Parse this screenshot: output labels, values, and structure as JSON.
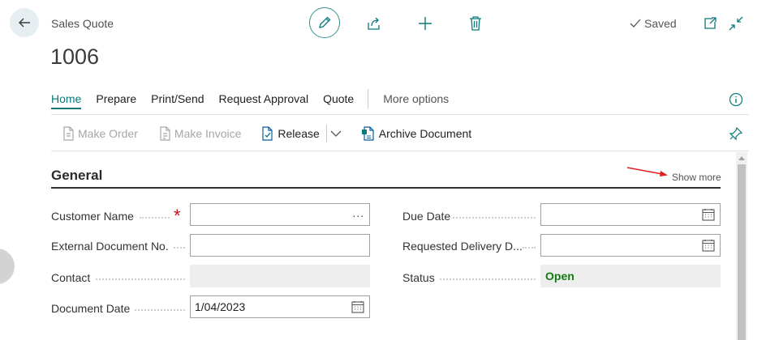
{
  "header": {
    "page_type": "Sales Quote",
    "document_number": "1006",
    "saved_label": "Saved",
    "icons": {
      "back": "back-arrow-icon",
      "edit": "pencil-icon",
      "share": "share-icon",
      "new": "plus-icon",
      "delete": "trash-icon",
      "saved": "checkmark-icon",
      "open_new_window": "open-new-window-icon",
      "collapse": "collapse-icon"
    }
  },
  "tabs": [
    {
      "label": "Home",
      "active": true
    },
    {
      "label": "Prepare"
    },
    {
      "label": "Print/Send"
    },
    {
      "label": "Request Approval"
    },
    {
      "label": "Quote"
    }
  ],
  "more_options_label": "More options",
  "actions": {
    "make_order": "Make Order",
    "make_invoice": "Make Invoice",
    "release": "Release",
    "archive": "Archive Document"
  },
  "general": {
    "title": "General",
    "show_more": "Show more",
    "fields": {
      "customer_name": {
        "label": "Customer Name",
        "value": "",
        "required": true,
        "lookup_icon": "..."
      },
      "external_doc_no": {
        "label": "External Document No.",
        "value": ""
      },
      "contact": {
        "label": "Contact",
        "value": ""
      },
      "document_date": {
        "label": "Document Date",
        "value": "1/04/2023"
      },
      "due_date": {
        "label": "Due Date",
        "value": ""
      },
      "requested_delivery": {
        "label": "Requested Delivery D...",
        "value": ""
      },
      "status": {
        "label": "Status",
        "value": "Open"
      }
    }
  },
  "colors": {
    "accent": "#0a7a7a",
    "status_open": "#107c10",
    "required": "#c50f1f",
    "annotation_arrow": "#e02020"
  }
}
